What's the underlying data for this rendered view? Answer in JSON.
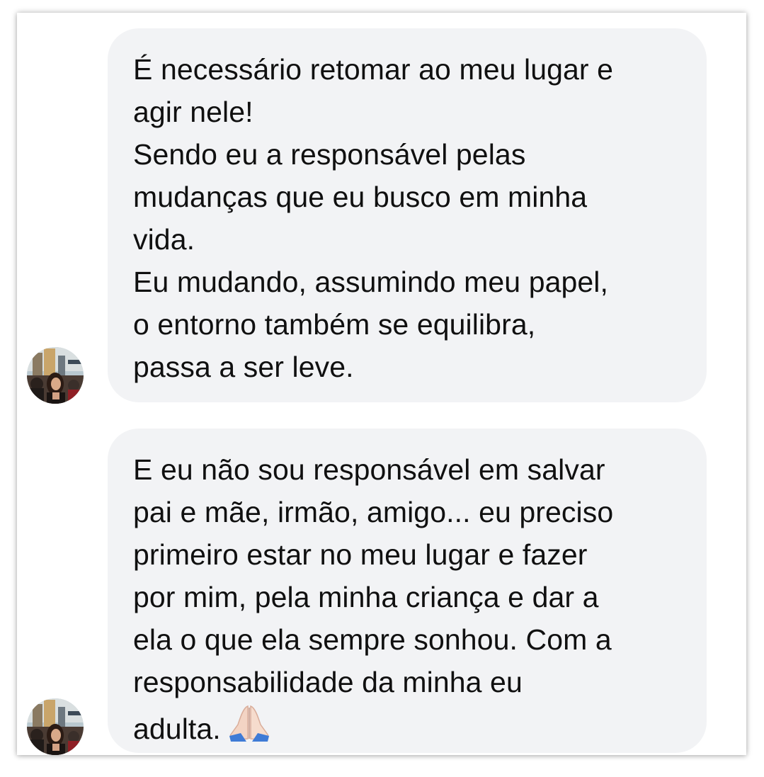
{
  "messages": [
    {
      "paragraphs": [
        "É necessário retomar ao meu lugar e\nagir nele!",
        "Sendo eu a responsável pelas\nmudanças que eu busco em minha\nvida.",
        "Eu mudando, assumindo meu papel,\no entorno também se equilibra,\npassa a ser leve."
      ]
    },
    {
      "paragraphs": [
        "E eu não sou responsável em salvar\npai e mãe, irmão, amigo... eu preciso\nprimeiro estar no meu lugar e fazer\npor mim, pela minha criança e dar a\nela o que ela sempre sonhou. Com a\nresponsabilidade da minha eu\nadulta."
      ],
      "trailing_emoji_icon": "folded-hands-icon"
    }
  ],
  "colors": {
    "bubble_background": "#f2f3f5",
    "text": "#101010"
  }
}
